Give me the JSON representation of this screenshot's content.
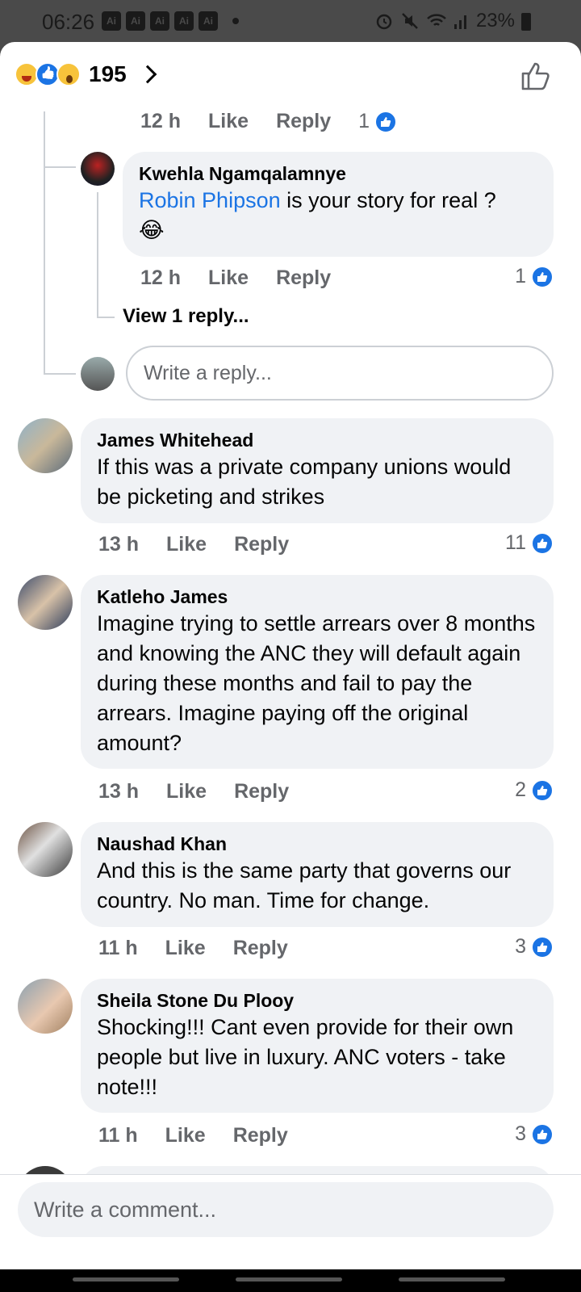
{
  "status_bar": {
    "time": "06:26",
    "ai_badges": [
      "Ai",
      "Ai",
      "Ai",
      "Ai",
      "Ai"
    ],
    "battery": "23%"
  },
  "header": {
    "reaction_count": "195"
  },
  "thread": {
    "prev_meta": {
      "time": "12 h",
      "like": "Like",
      "reply": "Reply",
      "likes": "1"
    },
    "nested_reply": {
      "author": "Kwehla Ngamqalamnye",
      "mention": "Robin Phipson",
      "text": " is your story for real ?",
      "emoji": "😂",
      "time": "12 h",
      "like": "Like",
      "reply": "Reply",
      "likes": "1"
    },
    "view_replies": "View 1 reply...",
    "reply_placeholder": "Write a reply..."
  },
  "comments": [
    {
      "author": "James Whitehead",
      "text": "If this was a private company unions would be picketing and strikes",
      "time": "13 h",
      "like": "Like",
      "reply": "Reply",
      "likes": "11"
    },
    {
      "author": "Katleho James",
      "text": "Imagine trying to settle arrears over 8 months and knowing the ANC they will default again during these months and fail to pay the arrears. Imagine paying off the original amount?",
      "time": "13 h",
      "like": "Like",
      "reply": "Reply",
      "likes": "2"
    },
    {
      "author": "Naushad Khan",
      "text": "And this is the same party that governs our country.  No man. Time for change.",
      "time": "11 h",
      "like": "Like",
      "reply": "Reply",
      "likes": "3"
    },
    {
      "author": "Sheila Stone Du Plooy",
      "text": "Shocking!!! Cant even provide for their own people but live in luxury. ANC voters - take note!!!",
      "time": "11 h",
      "like": "Like",
      "reply": "Reply",
      "likes": "3"
    }
  ],
  "composer": {
    "placeholder": "Write a comment..."
  },
  "colors": {
    "accent": "#1b74e4",
    "bubble": "#f0f2f5",
    "meta": "#65676b"
  }
}
